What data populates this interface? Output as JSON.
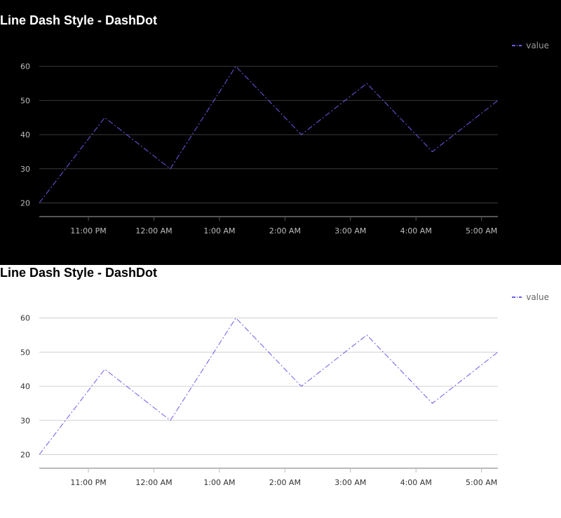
{
  "colors": {
    "series": "#6a5ce8"
  },
  "charts": [
    {
      "theme": "dark",
      "background": "#000000",
      "grid_color": "#3a3a3a",
      "axis_color": "#555555",
      "text_color": "#bdbdbd"
    },
    {
      "theme": "light",
      "background": "#ffffff",
      "grid_color": "#d0d0d0",
      "axis_color": "#bbbbbb",
      "text_color": "#333333"
    }
  ],
  "chart_data": [
    {
      "type": "line",
      "title": "Line Dash Style - DashDot",
      "line_style": "dashdot",
      "legend": {
        "entries": [
          "value"
        ],
        "position": "top-right"
      },
      "x_ticks": [
        "11:00 PM",
        "12:00 AM",
        "1:00 AM",
        "2:00 AM",
        "3:00 AM",
        "4:00 AM",
        "5:00 AM"
      ],
      "y_ticks": [
        20,
        30,
        40,
        50,
        60
      ],
      "xlim": [
        "10:15 PM",
        "5:15 AM"
      ],
      "ylim": [
        16,
        63
      ],
      "grid": true,
      "series": [
        {
          "name": "value",
          "x": [
            "10:15 PM",
            "11:15 PM",
            "12:15 AM",
            "1:15 AM",
            "2:15 AM",
            "3:15 AM",
            "4:15 AM",
            "5:15 AM"
          ],
          "y": [
            20,
            45,
            30,
            60,
            40,
            55,
            35,
            50
          ]
        }
      ]
    },
    {
      "type": "line",
      "title": "Line Dash Style - DashDot",
      "line_style": "dashdot",
      "legend": {
        "entries": [
          "value"
        ],
        "position": "top-right"
      },
      "x_ticks": [
        "11:00 PM",
        "12:00 AM",
        "1:00 AM",
        "2:00 AM",
        "3:00 AM",
        "4:00 AM",
        "5:00 AM"
      ],
      "y_ticks": [
        20,
        30,
        40,
        50,
        60
      ],
      "xlim": [
        "10:15 PM",
        "5:15 AM"
      ],
      "ylim": [
        16,
        63
      ],
      "grid": true,
      "series": [
        {
          "name": "value",
          "x": [
            "10:15 PM",
            "11:15 PM",
            "12:15 AM",
            "1:15 AM",
            "2:15 AM",
            "3:15 AM",
            "4:15 AM",
            "5:15 AM"
          ],
          "y": [
            20,
            45,
            30,
            60,
            40,
            55,
            35,
            50
          ]
        }
      ]
    }
  ]
}
